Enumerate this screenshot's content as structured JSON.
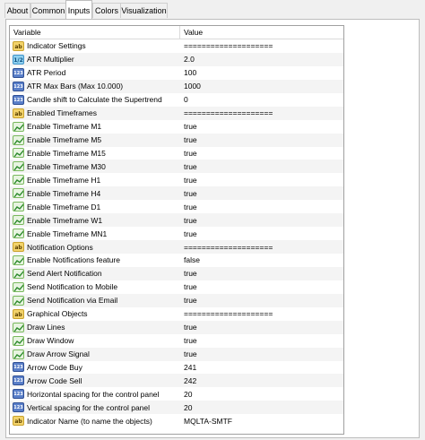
{
  "tabs": [
    "About",
    "Common",
    "Inputs",
    "Colors",
    "Visualization"
  ],
  "active_tab": "Inputs",
  "columns": {
    "variable": "Variable",
    "value": "Value"
  },
  "rows": [
    {
      "type": "string",
      "variable": "Indicator Settings",
      "value": "===================="
    },
    {
      "type": "double",
      "variable": "ATR Multiplier",
      "value": "2.0"
    },
    {
      "type": "integer",
      "variable": "ATR Period",
      "value": "100"
    },
    {
      "type": "integer",
      "variable": "ATR Max Bars (Max 10.000)",
      "value": "1000"
    },
    {
      "type": "integer",
      "variable": "Candle shift to Calculate the Supertrend",
      "value": "0"
    },
    {
      "type": "string",
      "variable": "Enabled Timeframes",
      "value": "===================="
    },
    {
      "type": "bool",
      "variable": "Enable Timeframe M1",
      "value": "true"
    },
    {
      "type": "bool",
      "variable": "Enable Timeframe M5",
      "value": "true"
    },
    {
      "type": "bool",
      "variable": "Enable Timeframe M15",
      "value": "true"
    },
    {
      "type": "bool",
      "variable": "Enable Timeframe M30",
      "value": "true"
    },
    {
      "type": "bool",
      "variable": "Enable Timeframe H1",
      "value": "true"
    },
    {
      "type": "bool",
      "variable": "Enable Timeframe H4",
      "value": "true"
    },
    {
      "type": "bool",
      "variable": "Enable Timeframe D1",
      "value": "true"
    },
    {
      "type": "bool",
      "variable": "Enable Timeframe W1",
      "value": "true"
    },
    {
      "type": "bool",
      "variable": "Enable Timeframe MN1",
      "value": "true"
    },
    {
      "type": "string",
      "variable": "Notification Options",
      "value": "===================="
    },
    {
      "type": "bool",
      "variable": "Enable Notifications feature",
      "value": "false"
    },
    {
      "type": "bool",
      "variable": "Send Alert Notification",
      "value": "true"
    },
    {
      "type": "bool",
      "variable": "Send Notification to Mobile",
      "value": "true"
    },
    {
      "type": "bool",
      "variable": "Send Notification via Email",
      "value": "true"
    },
    {
      "type": "string",
      "variable": "Graphical Objects",
      "value": "===================="
    },
    {
      "type": "bool",
      "variable": "Draw Lines",
      "value": "true"
    },
    {
      "type": "bool",
      "variable": "Draw Window",
      "value": "true"
    },
    {
      "type": "bool",
      "variable": "Draw Arrow Signal",
      "value": "true"
    },
    {
      "type": "integer",
      "variable": "Arrow Code Buy",
      "value": "241"
    },
    {
      "type": "integer",
      "variable": "Arrow Code Sell",
      "value": "242"
    },
    {
      "type": "integer",
      "variable": "Horizontal spacing for the control panel",
      "value": "20"
    },
    {
      "type": "integer",
      "variable": "Vertical spacing for the control panel",
      "value": "20"
    },
    {
      "type": "string",
      "variable": "Indicator Name (to name the objects)",
      "value": "MQLTA-SMTF"
    }
  ],
  "icon_names": {
    "string": "string-type-icon",
    "double": "double-type-icon",
    "integer": "integer-type-icon",
    "bool": "bool-type-icon"
  },
  "icon_glyphs": {
    "string": "ab",
    "double": "1/2",
    "integer": "123",
    "bool": ""
  },
  "colors": {
    "string_icon": "#f3d36b",
    "double_icon": "#8fd0f0",
    "integer_icon": "#5a7fc9",
    "bool_icon": "#78b85c"
  }
}
